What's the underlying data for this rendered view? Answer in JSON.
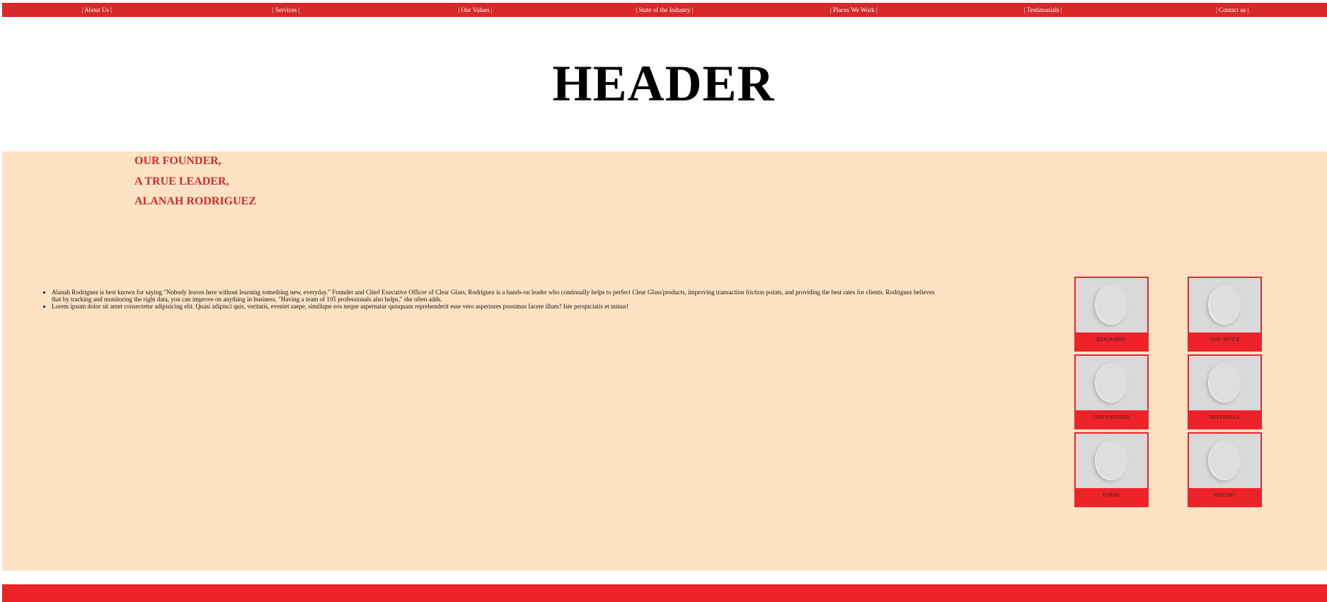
{
  "nav": {
    "items": [
      "| About Us |",
      "| Services |",
      "| Our Values |",
      "| State of the Industry |",
      "| Places We Work |",
      "| Testimonials |",
      "| Contact us |"
    ]
  },
  "header": {
    "title": "HEADER"
  },
  "founder": {
    "lines": [
      "OUR FOUNDER,",
      "A TRUE LEADER,",
      "ALANAH RODRIGUEZ"
    ]
  },
  "bio": {
    "items": [
      "Alanah Rodriguez is best known for saying \"Nobody leaves here without learning something new, everyday.\" Founder and Chief Executive Officer of Clear Glass, Rodriguez is a hands-on leader who continually helps to perfect Clear Glass'products, improving transaction friction points, and providing the best rates for clients. Rodriguez believes that by tracking and monitoring the right data, you can improve on anything in business. \"Having a team of 105 professionals also helps,\" she often adds.",
      "Lorem ipsum dolor sit amet consectetur adipisicing elit. Quasi adipisci quis, veritatis, eveniet saepe, similique eos neque aspernatur quisquam reprehenderit esse vero asperiores possimus facere illum? Iste perspiciatis et minus!"
    ]
  },
  "cards": [
    {
      "label": "BIOGRAPHY",
      "icon": "plate-image"
    },
    {
      "label": "OUR OFFICE",
      "icon": "plate-image"
    },
    {
      "label": "OUR FOUNDER",
      "icon": "plate-image"
    },
    {
      "label": "REFERRALS",
      "icon": "plate-image"
    },
    {
      "label": "FORMS",
      "icon": "plate-image"
    },
    {
      "label": "HISTORY",
      "icon": "plate-image"
    }
  ],
  "colors": {
    "nav": "#d8282a",
    "accent": "#ee2329",
    "main_bg": "#fde3c4",
    "heading": "#d8282a"
  }
}
